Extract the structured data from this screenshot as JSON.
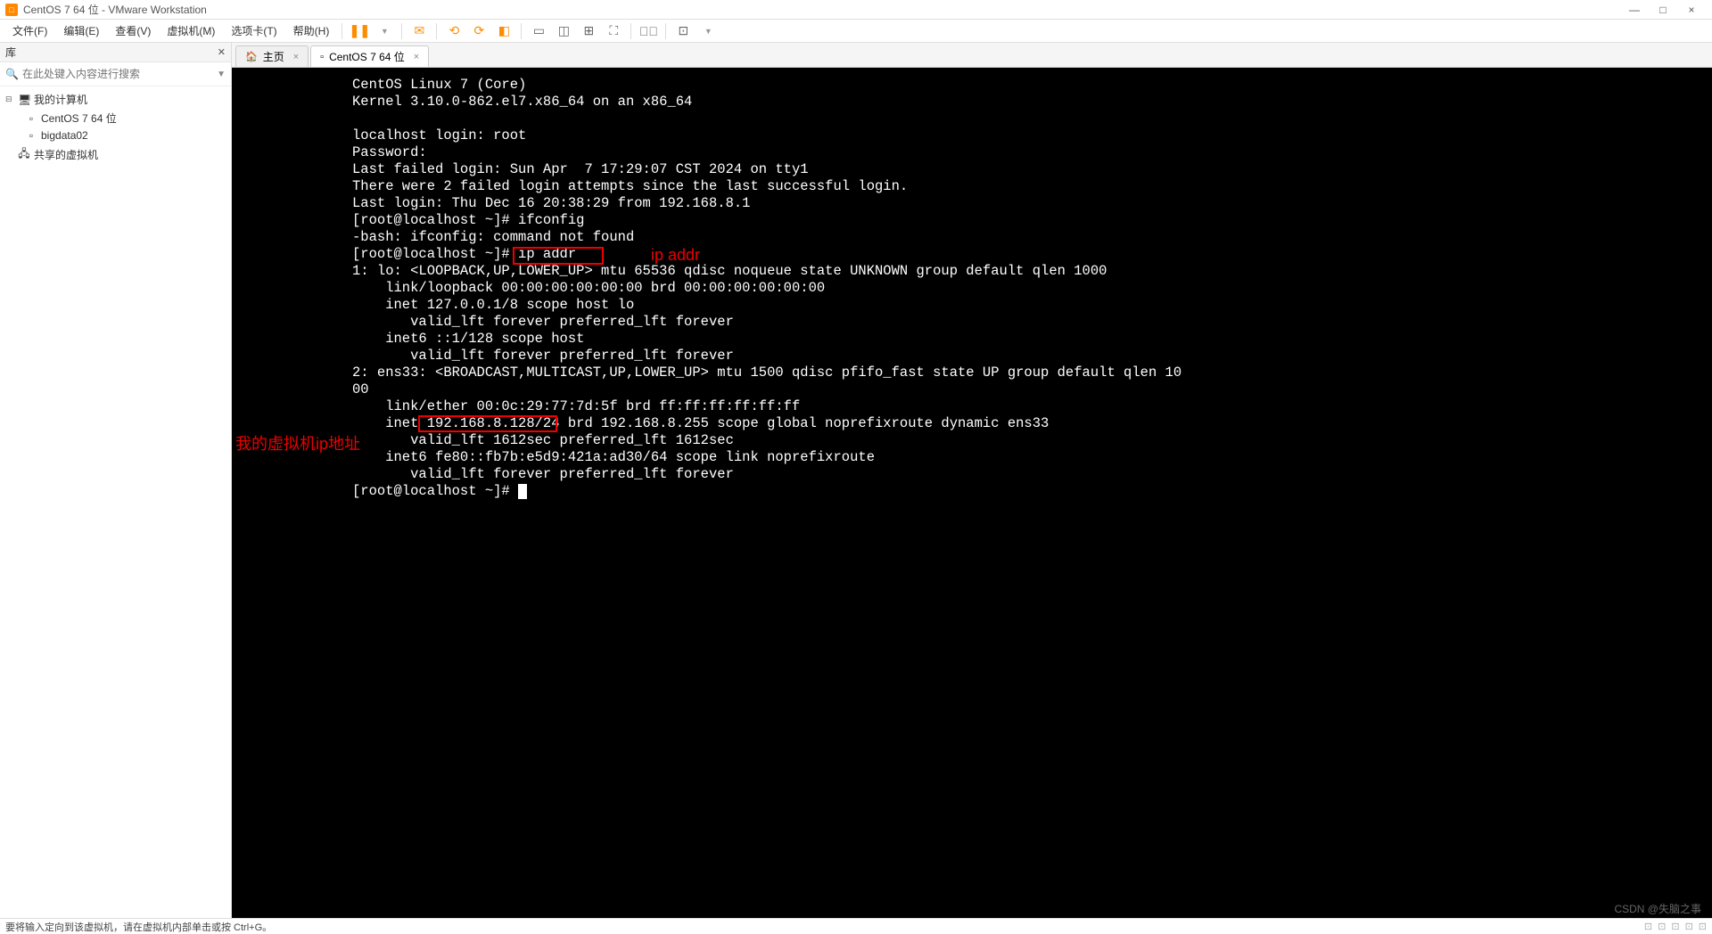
{
  "window": {
    "title": "CentOS 7 64 位 - VMware Workstation",
    "min": "—",
    "max": "□",
    "close": "×"
  },
  "menu": {
    "file": "文件(F)",
    "edit": "编辑(E)",
    "view": "查看(V)",
    "vm": "虚拟机(M)",
    "tabs": "选项卡(T)",
    "help": "帮助(H)"
  },
  "sidebar": {
    "title": "库",
    "search_placeholder": "在此处键入内容进行搜索",
    "root": "我的计算机",
    "item1": "CentOS 7 64 位",
    "item2": "bigdata02",
    "shared": "共享的虚拟机"
  },
  "tabs": {
    "home": "主页",
    "vm": "CentOS 7 64 位"
  },
  "terminal": {
    "lines": [
      "CentOS Linux 7 (Core)",
      "Kernel 3.10.0-862.el7.x86_64 on an x86_64",
      "",
      "localhost login: root",
      "Password:",
      "Last failed login: Sun Apr  7 17:29:07 CST 2024 on tty1",
      "There were 2 failed login attempts since the last successful login.",
      "Last login: Thu Dec 16 20:38:29 from 192.168.8.1",
      "[root@localhost ~]# ifconfig",
      "-bash: ifconfig: command not found",
      "[root@localhost ~]# ip addr",
      "1: lo: <LOOPBACK,UP,LOWER_UP> mtu 65536 qdisc noqueue state UNKNOWN group default qlen 1000",
      "    link/loopback 00:00:00:00:00:00 brd 00:00:00:00:00:00",
      "    inet 127.0.0.1/8 scope host lo",
      "       valid_lft forever preferred_lft forever",
      "    inet6 ::1/128 scope host",
      "       valid_lft forever preferred_lft forever",
      "2: ens33: <BROADCAST,MULTICAST,UP,LOWER_UP> mtu 1500 qdisc pfifo_fast state UP group default qlen 10",
      "00",
      "    link/ether 00:0c:29:77:7d:5f brd ff:ff:ff:ff:ff:ff",
      "    inet 192.168.8.128/24 brd 192.168.8.255 scope global noprefixroute dynamic ens33",
      "       valid_lft 1612sec preferred_lft 1612sec",
      "    inet6 fe80::fb7b:e5d9:421a:ad30/64 scope link noprefixroute",
      "       valid_lft forever preferred_lft forever",
      "[root@localhost ~]# "
    ]
  },
  "annotations": {
    "ip_addr_label": "ip addr",
    "my_vm_ip_label": "我的虚拟机ip地址"
  },
  "statusbar": {
    "text": "要将输入定向到该虚拟机，请在虚拟机内部单击或按 Ctrl+G。"
  },
  "watermark": "CSDN @失脑之事"
}
